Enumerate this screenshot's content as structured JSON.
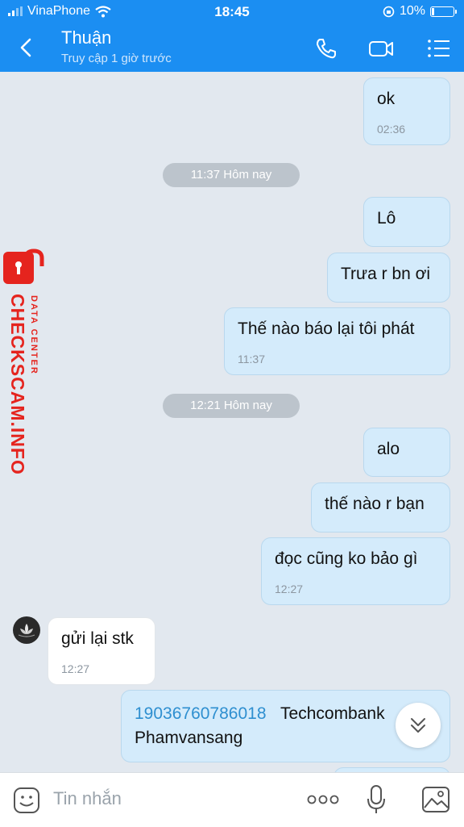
{
  "status_bar": {
    "carrier": "VinaPhone",
    "time": "18:45",
    "battery": "10%"
  },
  "header": {
    "contact_name": "Thuận",
    "last_seen": "Truy cập 1 giờ trước"
  },
  "messages": [
    {
      "text": "ok",
      "time": "02:36"
    },
    {
      "text": "11:37 Hôm nay"
    },
    {
      "text": "Lô"
    },
    {
      "text": "Trưa r bn ơi"
    },
    {
      "text": "Thế nào báo lại tôi phát",
      "time": "11:37"
    },
    {
      "text": "12:21 Hôm nay"
    },
    {
      "text": "alo"
    },
    {
      "text": "thế nào r bạn"
    },
    {
      "text": "đọc cũng ko bảo gì",
      "time": "12:27"
    },
    {
      "text": "gửi lại stk",
      "time": "12:27"
    },
    {
      "account": "19036760786018",
      "bank": "Techcombank",
      "name": "Phamvansang"
    }
  ],
  "watermark": {
    "main": "CHECKSCAM.INFO",
    "sub": "DATA CENTER"
  },
  "input": {
    "placeholder": "Tin nhắn"
  },
  "colors": {
    "header": "#1b8ef2",
    "outgoing_bubble": "#d4ebfb",
    "chat_background": "#e2e8ef",
    "watermark": "#e5241e",
    "link": "#2e8fd0"
  },
  "icons": [
    "back-icon",
    "phone-icon",
    "video-call-icon",
    "menu-icon",
    "emoji-icon",
    "more-icon",
    "microphone-icon",
    "image-icon",
    "scroll-down-icon",
    "lock-icon"
  ]
}
